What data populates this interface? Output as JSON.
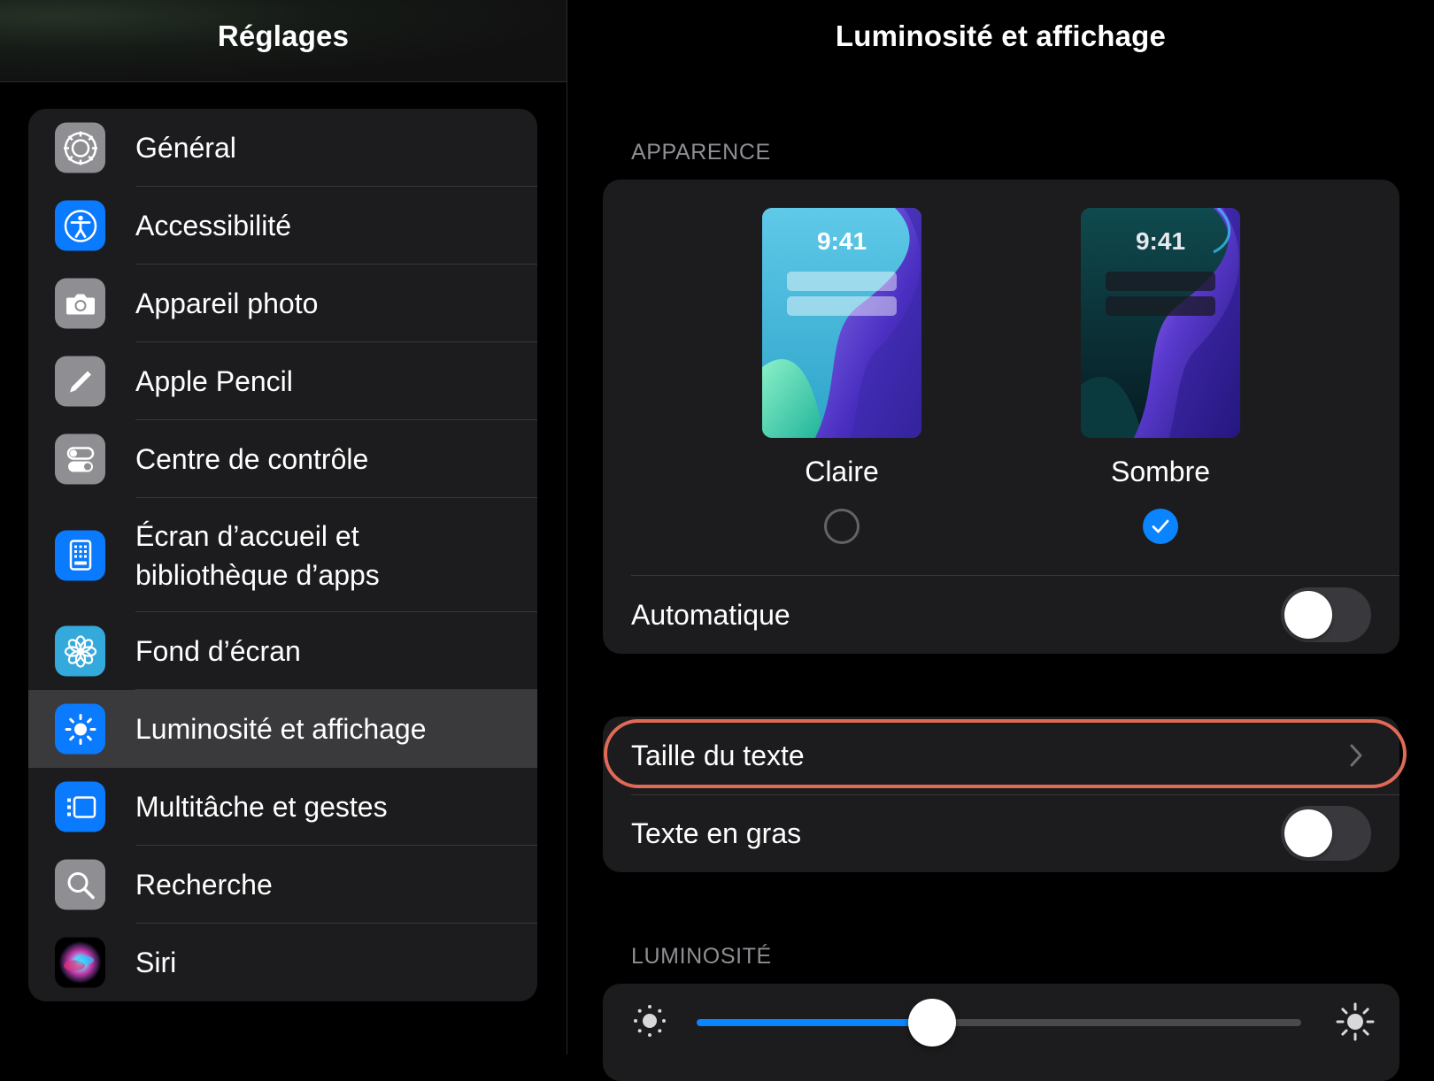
{
  "sidebar": {
    "title": "Réglages",
    "items": [
      {
        "label": "Général",
        "icon": "gear-icon",
        "color": "#8e8e93"
      },
      {
        "label": "Accessibilité",
        "icon": "accessibility-icon",
        "color": "#0a7aff"
      },
      {
        "label": "Appareil photo",
        "icon": "camera-icon",
        "color": "#8e8e93"
      },
      {
        "label": "Apple Pencil",
        "icon": "pencil-icon",
        "color": "#8e8e93"
      },
      {
        "label": "Centre de contrôle",
        "icon": "toggles-icon",
        "color": "#8e8e93"
      },
      {
        "label": "Écran d’accueil et bibliothèque d’apps",
        "icon": "home-screen-icon",
        "color": "#0a7aff"
      },
      {
        "label": "Fond d’écran",
        "icon": "flower-icon",
        "color": "#34aadc"
      },
      {
        "label": "Luminosité et affichage",
        "icon": "sun-icon",
        "color": "#0a7aff",
        "selected": true
      },
      {
        "label": "Multitâche et gestes",
        "icon": "multitask-icon",
        "color": "#0a7aff"
      },
      {
        "label": "Recherche",
        "icon": "search-icon",
        "color": "#8e8e93"
      },
      {
        "label": "Siri",
        "icon": "siri-icon",
        "color": "#000000"
      }
    ]
  },
  "detail": {
    "title": "Luminosité et affichage",
    "appearance": {
      "header": "APPARENCE",
      "light": {
        "label": "Claire",
        "time": "9:41",
        "selected": false
      },
      "dark": {
        "label": "Sombre",
        "time": "9:41",
        "selected": true
      },
      "automatic": {
        "label": "Automatique",
        "on": false
      }
    },
    "text": {
      "size_label": "Taille du texte",
      "bold_label": "Texte en gras",
      "bold_on": false
    },
    "brightness": {
      "header": "LUMINOSITÉ",
      "level": 0.39
    }
  },
  "colors": {
    "accent": "#0a84ff",
    "highlight": "#e06a57"
  }
}
